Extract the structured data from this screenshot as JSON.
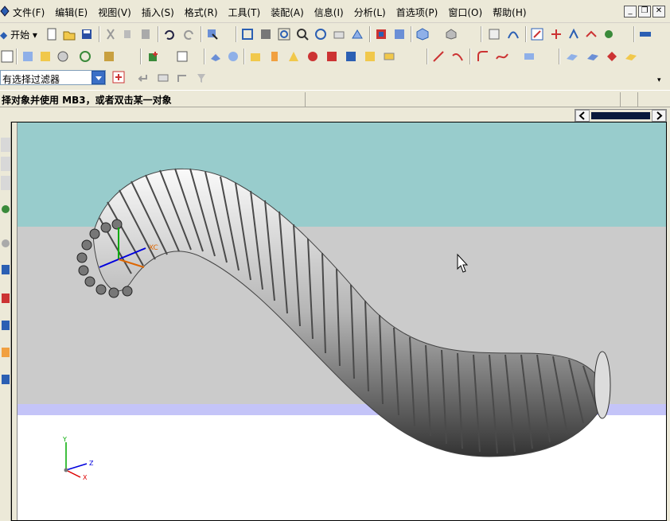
{
  "menubar": {
    "items": [
      "文件(F)",
      "编辑(E)",
      "视图(V)",
      "插入(S)",
      "格式(R)",
      "工具(T)",
      "装配(A)",
      "信息(I)",
      "分析(L)",
      "首选项(P)",
      "窗口(O)",
      "帮助(H)"
    ],
    "window_buttons": [
      "_",
      "❐",
      "✕"
    ]
  },
  "toolbar": {
    "start_label": "开始"
  },
  "selection": {
    "filter_value": "有选择过滤器"
  },
  "cue_line": {
    "prompt": "择对象并使用 MB3，或者双击某一对象"
  },
  "triad": {
    "x_label": "X",
    "y_label": "Y",
    "z_label": "Z",
    "wcs_label": "XC"
  },
  "colors": {
    "background_top": "#98cccc",
    "background_mid": "#cbcbcb",
    "band": "#c4c4f8",
    "accent": "#3a6fc6"
  }
}
